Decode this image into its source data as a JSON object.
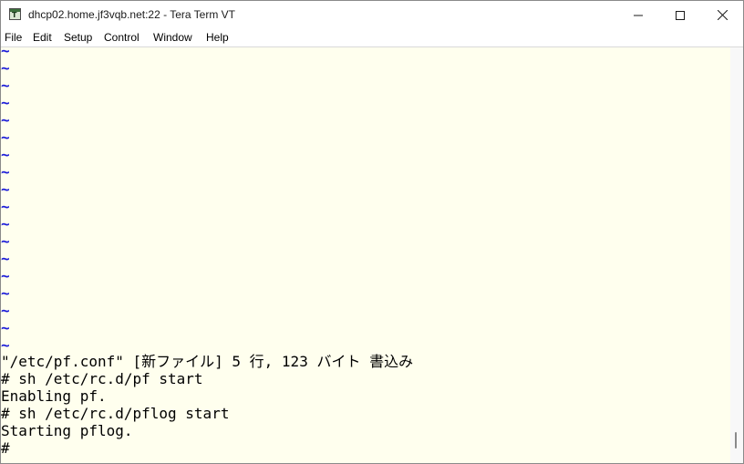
{
  "window": {
    "title": "dhcp02.home.jf3vqb.net:22 - Tera Term VT",
    "app_icon": "tera-term-icon",
    "controls": [
      "minimize-icon",
      "maximize-icon",
      "close-icon"
    ]
  },
  "menu": {
    "items": [
      "File",
      "Edit",
      "Setup",
      "Control",
      "Window",
      "Help"
    ]
  },
  "terminal": {
    "background": "#ffffee",
    "tilde_color": "#1a1ad8",
    "tilde_line": "~",
    "tilde_count": 18,
    "lines": [
      "\"/etc/pf.conf\" [新ファイル] 5 行, 123 バイト 書込み",
      "# sh /etc/rc.d/pf start",
      "Enabling pf.",
      "# sh /etc/rc.d/pflog start",
      "Starting pflog.",
      "#"
    ]
  }
}
